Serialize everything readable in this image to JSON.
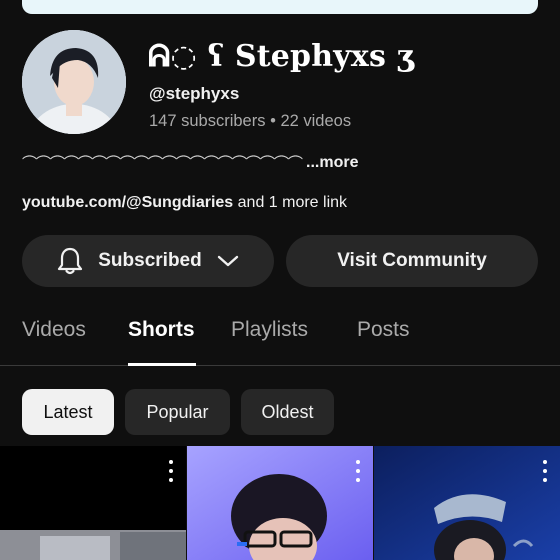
{
  "channel": {
    "name": "ᕱ◌ ʕ Stephyxs ʒ",
    "handle": "@stephyxs",
    "subscribers": "147 subscribers",
    "separator": "•",
    "videos": "22 videos",
    "description_waves": "⌒⌒⌒⌒⌒⌒⌒⌒⌒⌒⌒⌒⌒⌒⌒⌒⌒⌒⌒⌒",
    "more_label": "...more",
    "link_url": "youtube.com/@Sungdiaries",
    "link_extra": "and 1 more link"
  },
  "actions": {
    "subscribed_label": "Subscribed",
    "community_label": "Visit Community"
  },
  "tabs": [
    {
      "label": "Videos"
    },
    {
      "label": "Shorts"
    },
    {
      "label": "Playlists"
    },
    {
      "label": "Posts"
    }
  ],
  "active_tab": "Shorts",
  "sort_chips": [
    {
      "label": "Latest"
    },
    {
      "label": "Popular"
    },
    {
      "label": "Oldest"
    }
  ],
  "selected_chip": "Latest",
  "icons": {
    "bell": "bell-icon",
    "dropdown": "chevron-down-icon",
    "more": "more-vert-icon"
  },
  "colors": {
    "background": "#0f0f0f",
    "button_bg": "#272727",
    "chip_selected_bg": "#f1f1f1",
    "text_primary": "#f1f1f1",
    "text_secondary": "#aaaaaa",
    "banner": "#e8f6fa"
  }
}
